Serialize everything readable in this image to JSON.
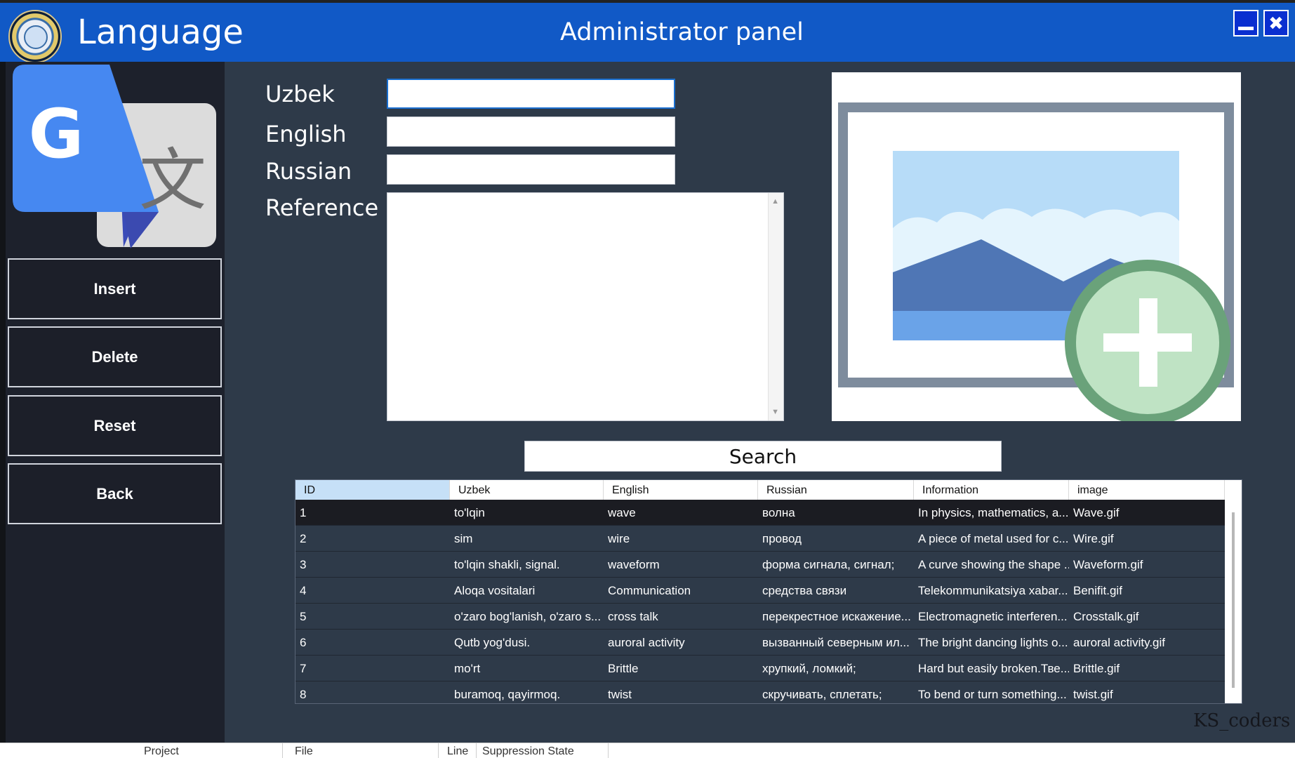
{
  "window": {
    "app_title": "Language",
    "panel_title": "Administrator panel",
    "minimize_icon": "minimize-icon",
    "close_icon": "close-icon",
    "close_glyph": "✖"
  },
  "sidebar": {
    "buttons": [
      "Insert",
      "Delete",
      "Reset",
      "Back"
    ]
  },
  "form": {
    "labels": {
      "uzbek": "Uzbek",
      "english": "English",
      "russian": "Russian",
      "reference": "Reference"
    },
    "values": {
      "uzbek": "",
      "english": "",
      "russian": "",
      "reference": ""
    }
  },
  "search": {
    "label": "Search"
  },
  "table": {
    "columns": [
      "ID",
      "Uzbek",
      "English",
      "Russian",
      "Information",
      "image"
    ],
    "rows": [
      [
        "1",
        "to'lqin",
        "wave",
        "волна",
        "In physics, mathematics, a...",
        "Wave.gif"
      ],
      [
        "2",
        "sim",
        "wire",
        "провод",
        "A piece of metal used for c...",
        "Wire.gif"
      ],
      [
        "3",
        "to'lqin shakli, signal.",
        "waveform",
        "форма сигнала, сигнал;",
        "A curve showing the shape ...",
        "Waveform.gif"
      ],
      [
        "4",
        "Aloqa vositalari",
        "Communication",
        "средства связи",
        "Telekommunikatsiya xabar...",
        "Benifit.gif"
      ],
      [
        "5",
        "o'zaro bog'lanish, o'zaro s...",
        "cross talk",
        "перекрестное искажение...",
        "Electromagnetic interferen...",
        "Crosstalk.gif"
      ],
      [
        "6",
        "Qutb yog'dusi.",
        "auroral activity",
        "вызванный северным ил...",
        "The bright dancing lights o...",
        "auroral activity.gif"
      ],
      [
        "7",
        "mo'rt",
        "Brittle",
        "хрупкий, ломкий;",
        "Hard but easily broken.Тве...",
        "Brittle.gif"
      ],
      [
        "8",
        "buramoq, qayirmoq.",
        "twist",
        "скручивать, сплетать;",
        "To bend or turn something...",
        "twist.gif"
      ]
    ],
    "selected_row": 1
  },
  "watermark": "KS_coders",
  "statusbar": {
    "project": "Project",
    "file": "File",
    "line": "Line",
    "suppression": "Suppression State"
  },
  "colors": {
    "titlebar": "#1159c6",
    "sidebar": "#1d212c",
    "main": "#2e3a49",
    "accent_green": "#6aa27a"
  }
}
